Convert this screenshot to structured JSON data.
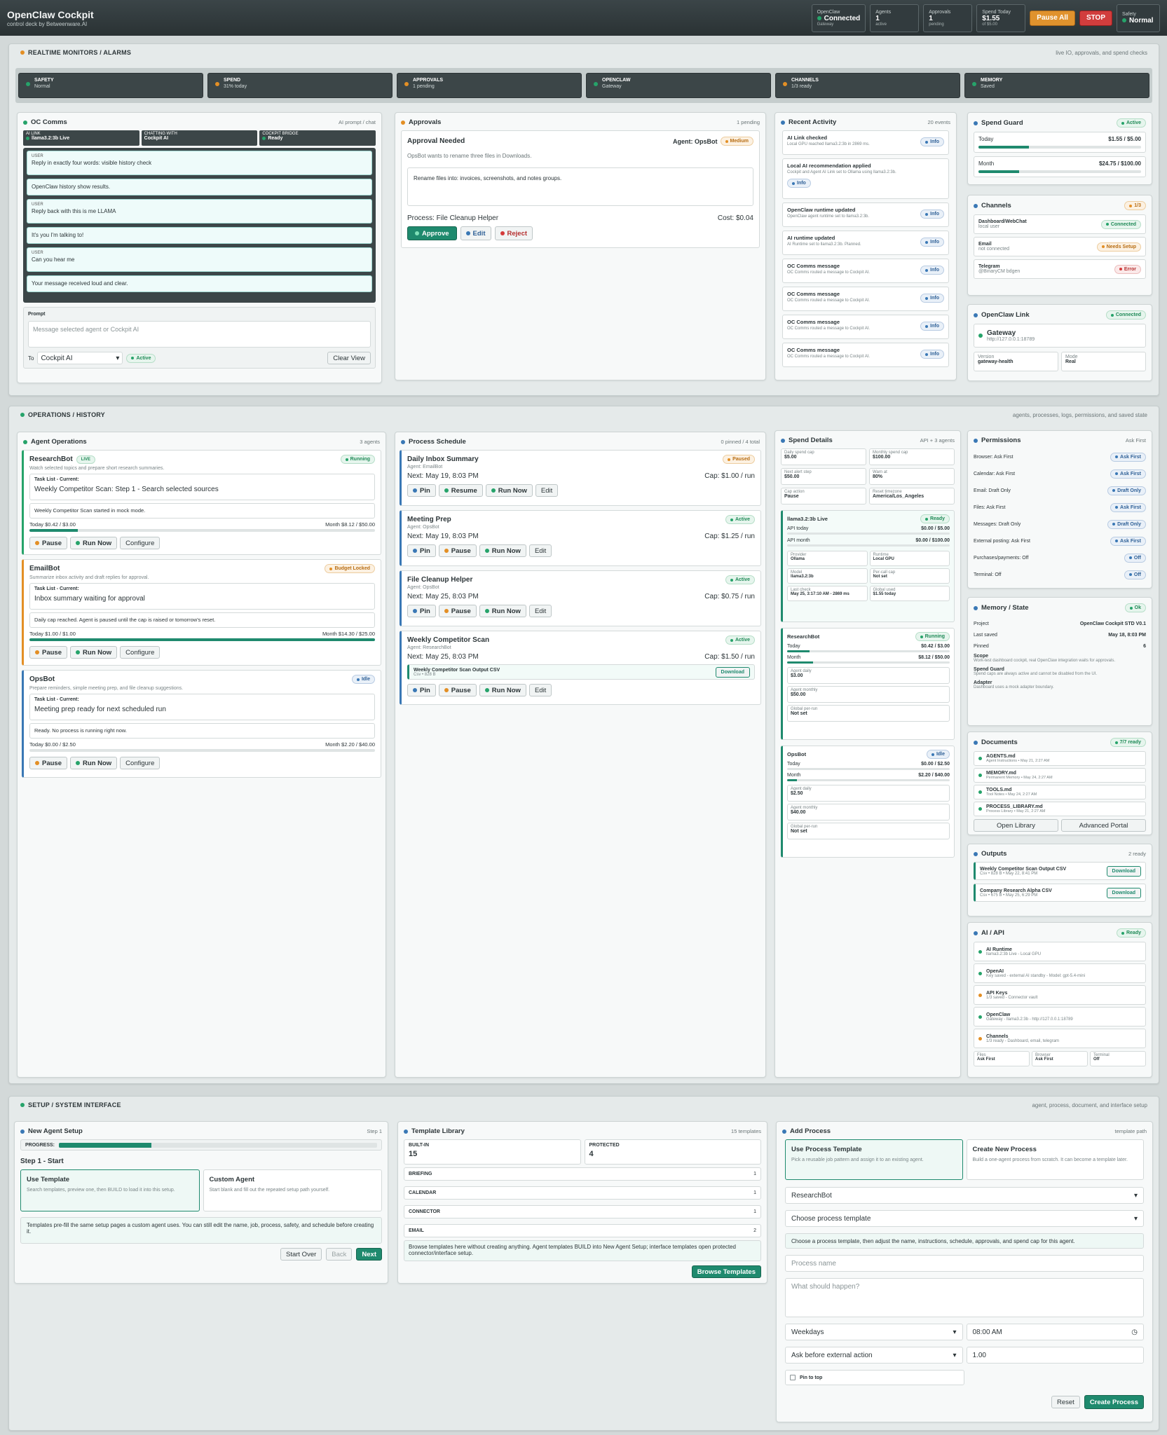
{
  "topbar": {
    "title": "OpenClaw Cockpit",
    "subtitle": "control deck by Betweenware.AI",
    "stats": [
      {
        "label": "OpenClaw",
        "value": "Connected",
        "detail": "Gateway",
        "dot": "green"
      },
      {
        "label": "Agents",
        "value": "1",
        "detail": "active"
      },
      {
        "label": "Approvals",
        "value": "1",
        "detail": "pending"
      },
      {
        "label": "Spend Today",
        "value": "$1.55",
        "detail": "of $5.00"
      }
    ],
    "pause_all": "Pause All",
    "stop": "STOP",
    "safety_label": "Safety",
    "safety_value": "Normal"
  },
  "monitors": {
    "title": "REALTIME MONITORS / ALARMS",
    "right": "live IO, approvals, and spend checks",
    "tiles": [
      {
        "label": "SAFETY",
        "value": "Normal",
        "dot": "green"
      },
      {
        "label": "SPEND",
        "value": "31% today",
        "dot": "orange"
      },
      {
        "label": "APPROVALS",
        "value": "1 pending",
        "dot": "orange"
      },
      {
        "label": "OPENCLAW",
        "value": "Gateway",
        "dot": "green"
      },
      {
        "label": "CHANNELS",
        "value": "1/3 ready",
        "dot": "orange"
      },
      {
        "label": "MEMORY",
        "value": "Saved",
        "dot": "green"
      }
    ]
  },
  "comms": {
    "title": "OC Comms",
    "right": "AI prompt / chat",
    "status": [
      {
        "label": "AI LINK",
        "value": "llama3.2:3b Live"
      },
      {
        "label": "CHATTING WITH",
        "value": "Cockpit AI"
      },
      {
        "label": "COCKPIT BRIDGE",
        "value": "Ready"
      }
    ],
    "messages": [
      {
        "who": "USER",
        "text": "Reply in exactly four words: visible history check"
      },
      {
        "who": "",
        "text": "OpenClaw history show results."
      },
      {
        "who": "USER",
        "text": "Reply back with this is me LLAMA"
      },
      {
        "who": "",
        "text": "It's you I'm talking to!"
      },
      {
        "who": "USER",
        "text": "Can you hear me"
      },
      {
        "who": "",
        "text": "Your message received loud and clear."
      }
    ],
    "prompt_label": "Prompt",
    "prompt_placeholder": "Message selected agent or Cockpit AI",
    "to_label": "To",
    "to_value": "Cockpit AI",
    "to_status": "Active",
    "clear": "Clear View"
  },
  "approvals": {
    "title": "Approvals",
    "right": "1 pending",
    "card_title": "Approval Needed",
    "agent": "Agent: OpsBot",
    "severity": "Medium",
    "desc": "OpsBot wants to rename three files in Downloads.",
    "detail": "Rename files into: invoices, screenshots, and notes groups.",
    "process": "Process: File Cleanup Helper",
    "cost": "Cost: $0.04",
    "approve": "Approve",
    "edit": "Edit",
    "reject": "Reject"
  },
  "activity": {
    "title": "Recent Activity",
    "right": "20 events",
    "items": [
      {
        "title": "AI Link checked",
        "desc": "Local GPU reached llama3.2:3b in 2869 ms.",
        "badge": "Info"
      },
      {
        "title": "Local AI recommendation applied",
        "desc": "Cockpit and Agent AI Link set to Ollama using llama3.2:3b.",
        "badge": "Info"
      },
      {
        "title": "OpenClaw runtime updated",
        "desc": "OpenClaw agent runtime set to llama3.2:3b.",
        "badge": "Info"
      },
      {
        "title": "AI runtime updated",
        "desc": "AI Runtime set to llama3.2:3b. Planned.",
        "badge": "Info"
      },
      {
        "title": "OC Comms message",
        "desc": "OC Comms routed a message to Cockpit AI.",
        "badge": "Info"
      },
      {
        "title": "OC Comms message",
        "desc": "OC Comms routed a message to Cockpit AI.",
        "badge": "Info"
      },
      {
        "title": "OC Comms message",
        "desc": "OC Comms routed a message to Cockpit AI.",
        "badge": "Info"
      },
      {
        "title": "OC Comms message",
        "desc": "OC Comms routed a message to Cockpit AI.",
        "badge": "Info"
      }
    ]
  },
  "spend_guard": {
    "title": "Spend Guard",
    "status": "Active",
    "rows": [
      {
        "label": "Today",
        "value": "$1.55 / $5.00",
        "pct": 31
      },
      {
        "label": "Month",
        "value": "$24.75 / $100.00",
        "pct": 25
      }
    ]
  },
  "channels": {
    "title": "Channels",
    "count": "1/3",
    "items": [
      {
        "name": "Dashboard/WebChat",
        "sub": "local user",
        "badge": "Connected",
        "tone": "g"
      },
      {
        "name": "Email",
        "sub": "not connected",
        "badge": "Needs Setup",
        "tone": "o"
      },
      {
        "name": "Telegram",
        "sub": "@BinaryCM bdgen",
        "badge": "Error",
        "tone": "r"
      }
    ]
  },
  "link": {
    "title": "OpenClaw Link",
    "status": "Connected",
    "gateway": "Gateway",
    "url": "http://127.0.0.1:18789",
    "version_label": "Version",
    "version": "gateway-health",
    "mode_label": "Mode",
    "mode": "Real"
  },
  "ops": {
    "title": "OPERATIONS / HISTORY",
    "right": "agents, processes, logs, permissions, and saved state"
  },
  "agents": {
    "title": "Agent Operations",
    "right": "3 agents",
    "items": [
      {
        "name": "ResearchBot",
        "live": "LIVE",
        "status": "Running",
        "tone": "g",
        "desc": "Watch selected topics and prepare short research summaries.",
        "task_label": "Task List - Current:",
        "task": "Weekly Competitor Scan: Step 1 - Search selected sources",
        "log": "Weekly Competitor Scan started in mock mode.",
        "today": "Today $0.42 / $3.00",
        "month": "Month $8.12 / $50.00",
        "pct": 14
      },
      {
        "name": "EmailBot",
        "live": "",
        "status": "Budget Locked",
        "tone": "o",
        "desc": "Summarize inbox activity and draft replies for approval.",
        "task_label": "Task List - Current:",
        "task": "Inbox summary waiting for approval",
        "log": "Daily cap reached. Agent is paused until the cap is raised or tomorrow's reset.",
        "today": "Today $1.00 / $1.00",
        "month": "Month $14.30 / $25.00",
        "pct": 100
      },
      {
        "name": "OpsBot",
        "live": "",
        "status": "Idle",
        "tone": "b",
        "desc": "Prepare reminders, simple meeting prep, and file cleanup suggestions.",
        "task_label": "Task List - Current:",
        "task": "Meeting prep ready for next scheduled run",
        "log": "Ready. No process is running right now.",
        "today": "Today $0.00 / $2.50",
        "month": "Month $2.20 / $40.00",
        "pct": 0
      }
    ],
    "pause": "Pause",
    "run": "Run Now",
    "configure": "Configure"
  },
  "schedule": {
    "title": "Process Schedule",
    "right": "0 pinned / 4 total",
    "items": [
      {
        "name": "Daily Inbox Summary",
        "agent": "Agent: EmailBot",
        "status": "Paused",
        "tone": "o",
        "next": "Next: May 19, 8:03 PM",
        "cap": "Cap: $1.00 / run",
        "mid": "Resume"
      },
      {
        "name": "Meeting Prep",
        "agent": "Agent: OpsBot",
        "status": "Active",
        "tone": "g",
        "next": "Next: May 19, 8:03 PM",
        "cap": "Cap: $1.25 / run",
        "mid": "Pause"
      },
      {
        "name": "File Cleanup Helper",
        "agent": "Agent: OpsBot",
        "status": "Active",
        "tone": "g",
        "next": "Next: May 25, 8:03 PM",
        "cap": "Cap: $0.75 / run",
        "mid": "Pause"
      },
      {
        "name": "Weekly Competitor Scan",
        "agent": "Agent: ResearchBot",
        "status": "Active",
        "tone": "g",
        "next": "Next: May 25, 8:03 PM",
        "cap": "Cap: $1.50 / run",
        "mid": "Pause"
      }
    ],
    "output_name": "Weekly Competitor Scan Output CSV",
    "output_sub": "Csv • 828 B",
    "download": "Download",
    "pin": "Pin",
    "run": "Run Now",
    "edit": "Edit"
  },
  "spend_details": {
    "title": "Spend Details",
    "right": "API + 3 agents",
    "caps": [
      {
        "l": "Daily spend cap",
        "v": "$5.00"
      },
      {
        "l": "Monthly spend cap",
        "v": "$100.00"
      },
      {
        "l": "Next alert step",
        "v": "$50.00"
      },
      {
        "l": "Warn at",
        "v": "80%"
      },
      {
        "l": "Cap action",
        "v": "Pause"
      },
      {
        "l": "Reset timezone",
        "v": "America/Los_Angeles"
      }
    ],
    "llama": {
      "name": "llama3.2:3b Live",
      "status": "Ready",
      "today_l": "API today",
      "today": "$0.00 / $5.00",
      "month_l": "API month",
      "month": "$0.00 / $100.00",
      "grid": [
        {
          "l": "Provider",
          "v": "Ollama"
        },
        {
          "l": "Runtime",
          "v": "Local GPU"
        },
        {
          "l": "Model",
          "v": "llama3.2:3b"
        },
        {
          "l": "Per-call cap",
          "v": "Not set"
        },
        {
          "l": "Last check",
          "v": "May 25, 3:17:10 AM - 2869 ms"
        },
        {
          "l": "Global used",
          "v": "$1.55 today"
        }
      ]
    },
    "agents": [
      {
        "name": "ResearchBot",
        "status": "Running",
        "tone": "g",
        "today": "$0.42 / $3.00",
        "month": "$8.12 / $50.00",
        "tp": 14,
        "mp": 16,
        "daily": "$3.00",
        "monthly": "$50.00",
        "per": "Not set"
      },
      {
        "name": "OpsBot",
        "status": "Idle",
        "tone": "b",
        "today": "$0.00 / $2.50",
        "month": "$2.20 / $40.00",
        "tp": 0,
        "mp": 6,
        "daily": "$2.50",
        "monthly": "$40.00",
        "per": "Not set"
      }
    ],
    "today_l": "Today",
    "month_l": "Month",
    "daily_l": "Agent daily",
    "monthly_l": "Agent monthly",
    "per_l": "Global per-run"
  },
  "permissions": {
    "title": "Permissions",
    "right": "Ask First",
    "items": [
      {
        "l": "Browser: Ask First",
        "v": "Ask First"
      },
      {
        "l": "Calendar: Ask First",
        "v": "Ask First"
      },
      {
        "l": "Email: Draft Only",
        "v": "Draft Only"
      },
      {
        "l": "Files: Ask First",
        "v": "Ask First"
      },
      {
        "l": "Messages: Draft Only",
        "v": "Draft Only"
      },
      {
        "l": "External posting: Ask First",
        "v": "Ask First"
      },
      {
        "l": "Purchases/payments: Off",
        "v": "Off"
      },
      {
        "l": "Terminal: Off",
        "v": "Off"
      }
    ]
  },
  "memory": {
    "title": "Memory / State",
    "status": "Ok",
    "rows": [
      {
        "l": "Project",
        "v": "OpenClaw Cockpit STD V0.1"
      },
      {
        "l": "Last saved",
        "v": "May 18, 8:03 PM"
      },
      {
        "l": "Pinned",
        "v": "6"
      }
    ],
    "blocks": [
      {
        "t": "Scope",
        "d": "Work-test dashboard cockpit, real OpenClaw integration waits for approvals."
      },
      {
        "t": "Spend Guard",
        "d": "Spend caps are always active and cannot be disabled from the UI."
      },
      {
        "t": "Adapter",
        "d": "Dashboard uses a mock adapter boundary."
      }
    ]
  },
  "documents": {
    "title": "Documents",
    "status": "7/7 ready",
    "items": [
      {
        "n": "AGENTS.md",
        "d": "Agent Instructions • May 21, 2:27 AM"
      },
      {
        "n": "MEMORY.md",
        "d": "Permanent Memory • May 24, 2:27 AM"
      },
      {
        "n": "TOOLS.md",
        "d": "Tool Notes • May 24, 2:27 AM"
      },
      {
        "n": "PROCESS_LIBRARY.md",
        "d": "Process Library • May 21, 2:27 AM"
      }
    ],
    "open": "Open Library",
    "portal": "Advanced Portal"
  },
  "outputs": {
    "title": "Outputs",
    "right": "2 ready",
    "items": [
      {
        "n": "Weekly Competitor Scan Output CSV",
        "d": "Csv • 828 B • May 22, 8:41 PM"
      },
      {
        "n": "Company Research Alpha CSV",
        "d": "Csv • 675 B • May 25, 6:29 PM"
      }
    ],
    "download": "Download"
  },
  "ai_api": {
    "title": "AI / API",
    "status": "Ready",
    "items": [
      {
        "n": "AI Runtime",
        "d": "llama3.2:3b Live - Local GPU",
        "c": "g"
      },
      {
        "n": "OpenAI",
        "d": "Key saved - external AI standby - Model: gpt-5.4-mini",
        "c": "g"
      },
      {
        "n": "API Keys",
        "d": "1/3 saved - Connector vault",
        "c": "o"
      },
      {
        "n": "OpenClaw",
        "d": "Gateway - llama3.2:3b - http://127.0.0.1:18789",
        "c": "g"
      },
      {
        "n": "Channels",
        "d": "1/3 ready - Dashboard, email, telegram",
        "c": "o"
      }
    ],
    "foot": [
      {
        "l": "Files",
        "v": "Ask First"
      },
      {
        "l": "Browser",
        "v": "Ask First"
      },
      {
        "l": "Terminal",
        "v": "Off"
      }
    ]
  },
  "setup": {
    "title": "SETUP / SYSTEM INTERFACE",
    "right": "agent, process, document, and interface setup"
  },
  "new_agent": {
    "title": "New Agent Setup",
    "right": "Step 1",
    "progress_label": "PROGRESS:",
    "progress": 29,
    "step": "Step 1 - Start",
    "opt1_t": "Use Template",
    "opt1_d": "Search templates, preview one, then BUILD to load it into this setup.",
    "opt2_t": "Custom Agent",
    "opt2_d": "Start blank and fill out the repeated setup path yourself.",
    "note": "Templates pre-fill the same setup pages a custom agent uses. You can still edit the name, job, process, safety, and schedule before creating it.",
    "start_over": "Start Over",
    "back": "Back",
    "next": "Next"
  },
  "templates": {
    "title": "Template Library",
    "right": "15 templates",
    "builtin_l": "BUILT-IN",
    "builtin": "15",
    "protected_l": "PROTECTED",
    "protected": "4",
    "cats": [
      {
        "n": "BRIEFING",
        "c": "1"
      },
      {
        "n": "CALENDAR",
        "c": "1"
      },
      {
        "n": "CONNECTOR",
        "c": "1"
      },
      {
        "n": "EMAIL",
        "c": "2"
      }
    ],
    "note": "Browse templates here without creating anything. Agent templates BUILD into New Agent Setup; interface templates open protected connector/interface setup.",
    "browse": "Browse Templates"
  },
  "add_process": {
    "title": "Add Process",
    "right": "template path",
    "opt1_t": "Use Process Template",
    "opt1_d": "Pick a reusable job pattern and assign it to an existing agent.",
    "opt2_t": "Create New Process",
    "opt2_d": "Build a one-agent process from scratch. It can become a template later.",
    "agent": "ResearchBot",
    "template": "Choose process template",
    "note": "Choose a process template, then adjust the name, instructions, schedule, approvals, and spend cap for this agent.",
    "name_ph": "Process name",
    "what_ph": "What should happen?",
    "days": "Weekdays",
    "time": "08:00 AM",
    "approval": "Ask before external action",
    "cap": "1.00",
    "pin": "Pin to top",
    "reset": "Reset",
    "create": "Create Process"
  }
}
